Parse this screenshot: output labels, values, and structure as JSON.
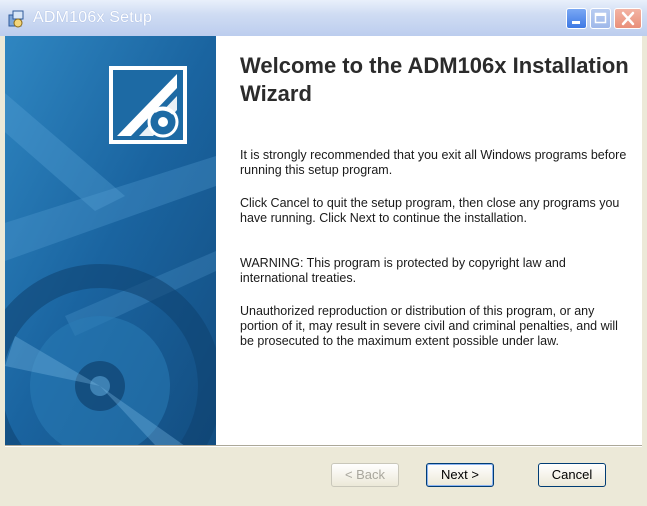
{
  "window": {
    "title": "ADM106x Setup",
    "icon": "installer-icon"
  },
  "titlebar_buttons": {
    "minimize_icon": "minimize-icon",
    "maximize_icon": "maximize-icon",
    "close_icon": "close-icon"
  },
  "banner": {
    "logo_icon": "setup-logo-icon",
    "colors": {
      "background": "#1d6aa4",
      "logo_frame": "#ffffff"
    }
  },
  "content": {
    "heading": "Welcome to the ADM106x Installation Wizard",
    "paragraphs": [
      "It is strongly recommended that you exit all Windows programs before running this setup program.",
      "Click Cancel to quit the setup program, then close any programs you have running.  Click Next to continue the installation.",
      "WARNING: This program is protected by copyright law and international treaties.",
      "Unauthorized reproduction or distribution of this program, or any portion of it, may result in severe civil and criminal penalties, and will be prosecuted to the maximum extent possible under law."
    ]
  },
  "buttons": {
    "back": "< Back",
    "next": "Next >",
    "cancel": "Cancel"
  }
}
